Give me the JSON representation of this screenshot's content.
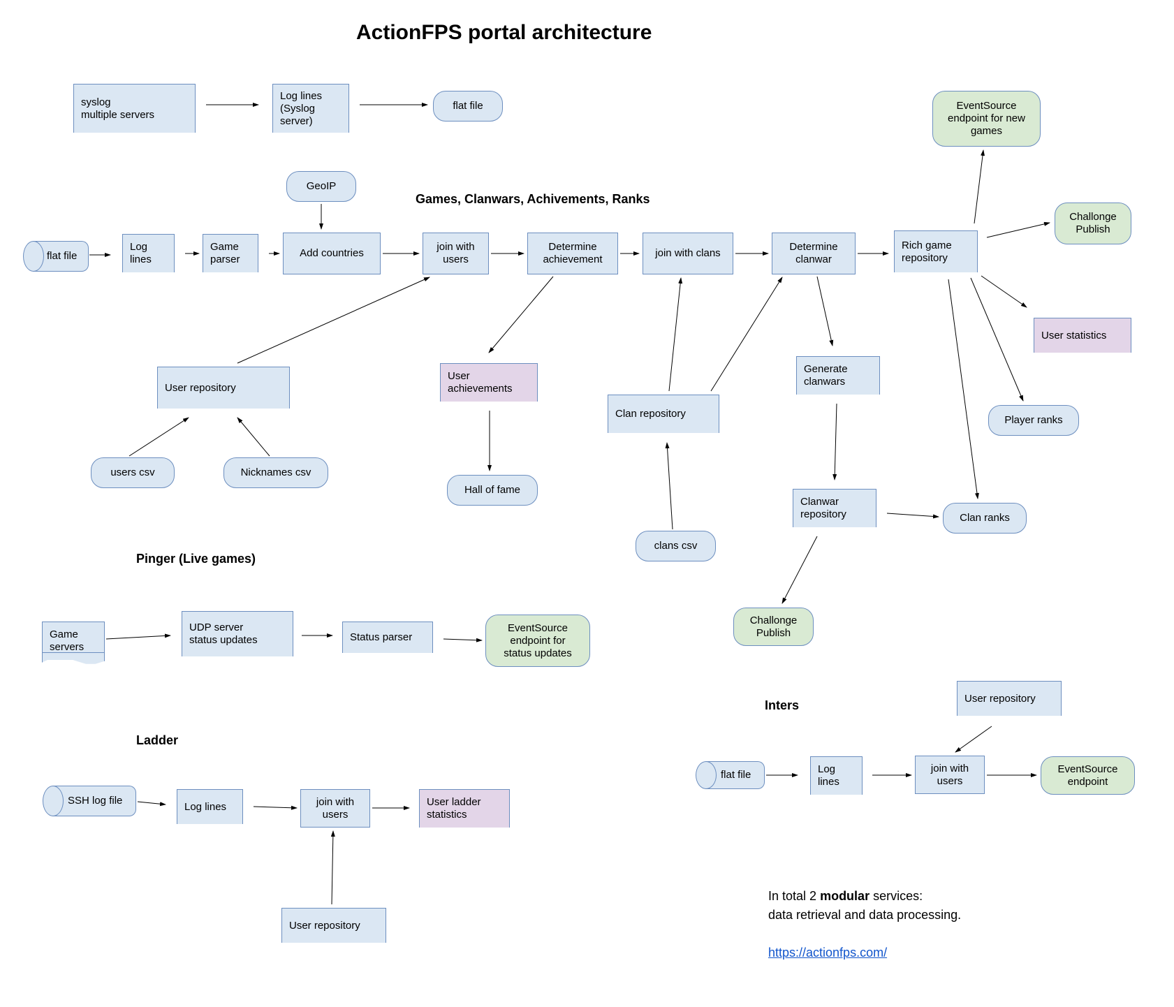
{
  "title": "ActionFPS portal architecture",
  "sections": {
    "games": "Games, Clanwars, Achivements, Ranks",
    "pinger": "Pinger (Live games)",
    "ladder": "Ladder",
    "inters": "Inters"
  },
  "nodes": {
    "syslog": "syslog\nmultiple servers",
    "log_lines_sys": "Log lines\n(Syslog\nserver)",
    "flat_file_top": "flat file",
    "flat_file_left": "flat file",
    "log_lines": "Log lines",
    "game_parser": "Game\nparser",
    "geoip": "GeoIP",
    "add_countries": "Add countries",
    "join_users": "join with\nusers",
    "det_achieve": "Determine\nachievement",
    "join_clans": "join with clans",
    "det_clanwar": "Determine\nclanwar",
    "rich_repo": "Rich game\nrepository",
    "event_new_games": "EventSource\nendpoint for new\ngames",
    "challonge_pub": "Challonge\nPublish",
    "user_stats": "User statistics",
    "player_ranks": "Player ranks",
    "clan_ranks": "Clan ranks",
    "user_repo": "User repository",
    "users_csv": "users csv",
    "nicknames_csv": "Nicknames csv",
    "user_achieve": "User\nachievements",
    "hall_fame": "Hall of fame",
    "clan_repo": "Clan repository",
    "clans_csv": "clans csv",
    "gen_clanwars": "Generate\nclanwars",
    "clanwar_repo": "Clanwar\nrepository",
    "challonge_pub2": "Challonge\nPublish",
    "game_servers": "Game\nservers",
    "udp_status": "UDP server\nstatus updates",
    "status_parser": "Status parser",
    "event_status": "EventSource\nendpoint for\nstatus updates",
    "ssh_log": "SSH log file",
    "ladder_log_lines": "Log lines",
    "ladder_join_users": "join with\nusers",
    "ladder_stats": "User ladder\nstatistics",
    "ladder_user_repo": "User repository",
    "inters_flat_file": "flat file",
    "inters_log_lines": "Log\nlines",
    "inters_join_users": "join with\nusers",
    "inters_user_repo": "User repository",
    "inters_event": "EventSource\nendpoint"
  },
  "footer": {
    "line1_a": "In total 2 ",
    "line1_b": "modular",
    "line1_c": " services:",
    "line2": "data retrieval and data processing.",
    "url": "https://actionfps.com/"
  }
}
